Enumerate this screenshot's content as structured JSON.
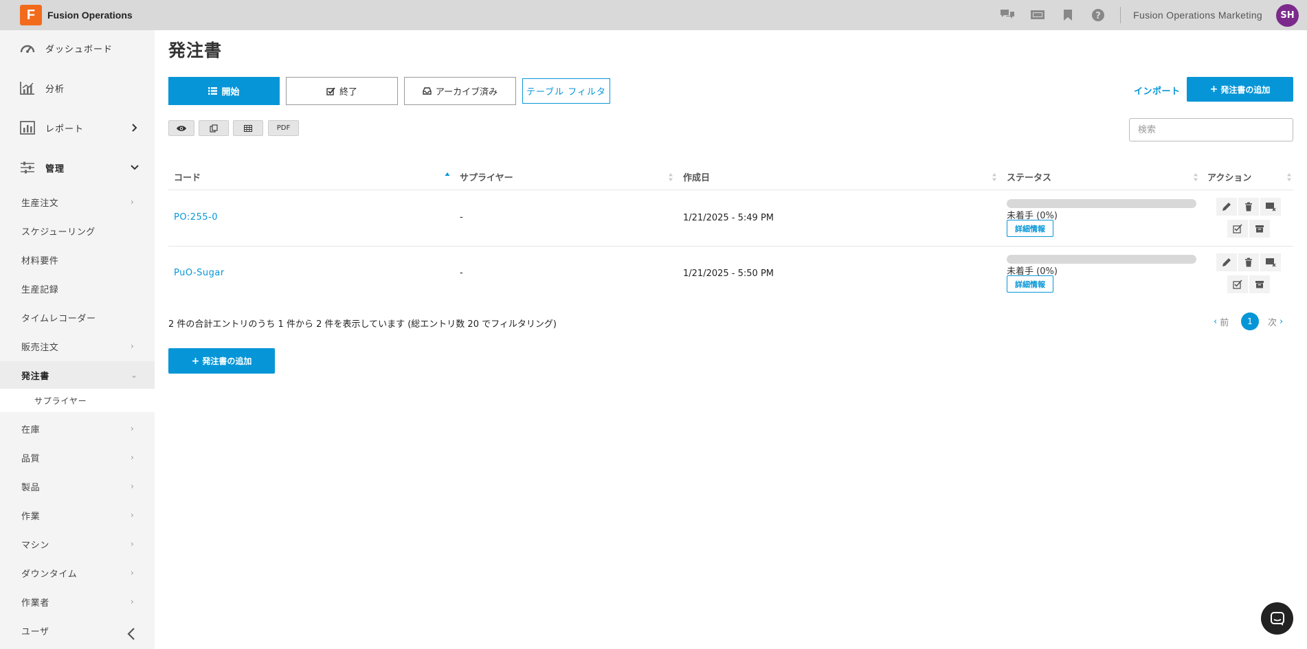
{
  "app": {
    "logo_letter": "F",
    "title": "Fusion Operations"
  },
  "topbar": {
    "icons": [
      "chat-bubbles-icon",
      "slideshow-icon",
      "bookmark-icon",
      "help-icon"
    ],
    "org_name": "Fusion Operations Marketing",
    "avatar_initials": "SH"
  },
  "sidebar": {
    "main_items": [
      {
        "label": "ダッシュボード",
        "icon": "dashboard-gauge-icon"
      },
      {
        "label": "分析",
        "icon": "analytics-chart-icon"
      },
      {
        "label": "レポート",
        "icon": "report-chart-icon"
      },
      {
        "label": "管理",
        "icon": "sliders-icon"
      }
    ],
    "sub_items": [
      "生産注文",
      "スケジューリング",
      "材料要件",
      "生産記録",
      "タイムレコーダー",
      "販売注文",
      "発注書"
    ],
    "sub_sub_item": "サプライヤー",
    "more_items": [
      "在庫",
      "品質",
      "製品",
      "作業",
      "マシン",
      "ダウンタイム",
      "作業者",
      "ユーザ"
    ]
  },
  "page": {
    "title": "発注書"
  },
  "tabs": {
    "open": "開始",
    "closed": "終了",
    "archived": "アーカイブ済み",
    "filter": "テーブル フィルタ"
  },
  "actions": {
    "import": "インポート",
    "add_po": "発注書の追加"
  },
  "toolbar": {
    "pdf": "PDF"
  },
  "search": {
    "placeholder": "検索"
  },
  "table": {
    "headers": {
      "code": "コード",
      "supplier": "サプライヤー",
      "created": "作成日",
      "status": "ステータス",
      "actions": "アクション"
    },
    "rows": [
      {
        "code": "PO:255-0",
        "supplier": "-",
        "created": "1/21/2025 - 5:49 PM",
        "status": "未着手 (0%)",
        "progress": 0,
        "detail": "詳細情報"
      },
      {
        "code": "PuO-Sugar",
        "supplier": "-",
        "created": "1/21/2025 - 5:50 PM",
        "status": "未着手 (0%)",
        "progress": 0,
        "detail": "詳細情報"
      }
    ]
  },
  "summary": "2 件の合計エントリのうち 1 件から 2 件を表示しています (総エントリ数 20 でフィルタリング)",
  "pagination": {
    "prev": "前",
    "current": "1",
    "next": "次"
  },
  "colors": {
    "accent": "#0696d7",
    "logo": "#f26b1d",
    "avatar": "#7b2a8c"
  }
}
